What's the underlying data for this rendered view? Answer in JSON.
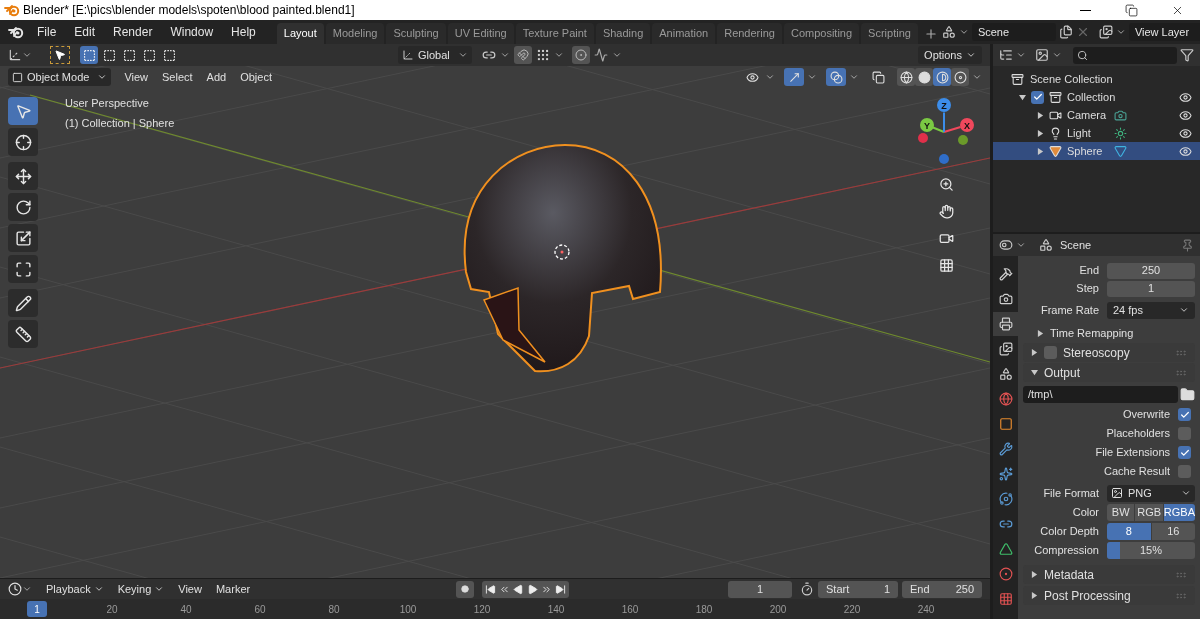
{
  "window": {
    "title": "Blender* [E:\\pics\\blender models\\spoten\\blood painted.blend1]"
  },
  "menus": [
    "File",
    "Edit",
    "Render",
    "Window",
    "Help"
  ],
  "workspaces": [
    {
      "label": "Layout",
      "selected": true
    },
    {
      "label": "Modeling",
      "selected": false
    },
    {
      "label": "Sculpting",
      "selected": false
    },
    {
      "label": "UV Editing",
      "selected": false
    },
    {
      "label": "Texture Paint",
      "selected": false
    },
    {
      "label": "Shading",
      "selected": false
    },
    {
      "label": "Animation",
      "selected": false
    },
    {
      "label": "Rendering",
      "selected": false
    },
    {
      "label": "Compositing",
      "selected": false
    },
    {
      "label": "Scripting",
      "selected": false
    }
  ],
  "scene": {
    "value": "Scene"
  },
  "view_layer": {
    "value": "View Layer"
  },
  "tool_header": {
    "select_modes": [
      {
        "selected": true
      },
      {
        "selected": false
      },
      {
        "selected": false
      },
      {
        "selected": false
      },
      {
        "selected": false
      }
    ],
    "orientation": "Global",
    "options": "Options"
  },
  "viewport_header": {
    "mode": "Object Mode",
    "menus": [
      "View",
      "Select",
      "Add",
      "Object"
    ],
    "toggles": [
      {
        "kind": "visibility",
        "on": false
      },
      {
        "kind": "gizmo",
        "on": true
      },
      {
        "kind": "overlay",
        "on": true
      },
      {
        "kind": "xray",
        "on": false
      }
    ],
    "shading": [
      {
        "kind": "wireframe",
        "selected": false
      },
      {
        "kind": "solid",
        "selected": false
      },
      {
        "kind": "material",
        "selected": true
      },
      {
        "kind": "rendered",
        "selected": false
      }
    ]
  },
  "viewport": {
    "overlay_text": [
      "User Perspective",
      "(1) Collection | Sphere"
    ],
    "gizmo_axes": {
      "z": "Z",
      "y": "Y",
      "x": "X"
    }
  },
  "tool_groups": [
    [
      {
        "kind": "select",
        "selected": true
      },
      {
        "kind": "cursor",
        "selected": false
      }
    ],
    [
      {
        "kind": "move",
        "selected": false
      },
      {
        "kind": "rotate",
        "selected": false
      },
      {
        "kind": "scale",
        "selected": false
      },
      {
        "kind": "transform",
        "selected": false
      }
    ],
    [
      {
        "kind": "annotate",
        "selected": false
      },
      {
        "kind": "measure",
        "selected": false
      }
    ]
  ],
  "timeline": {
    "menus": [
      {
        "label": "Playback",
        "dropdown": true
      },
      {
        "label": "Keying",
        "dropdown": true
      },
      {
        "label": "View",
        "dropdown": false
      },
      {
        "label": "Marker",
        "dropdown": false
      }
    ],
    "current_frame": "1",
    "start_label": "Start",
    "start": "1",
    "end_label": "End",
    "end": "250",
    "ruler": {
      "current": "1",
      "ticks": [
        "20",
        "40",
        "60",
        "80",
        "100",
        "120",
        "140",
        "160",
        "180",
        "200",
        "220",
        "240"
      ]
    }
  },
  "outliner": {
    "root": "Scene Collection",
    "tree": [
      {
        "label": "Collection",
        "expanded": true,
        "checked": true,
        "selected": false,
        "children": [
          {
            "label": "Camera",
            "kind": "camera",
            "expanded": false,
            "selected": false
          },
          {
            "label": "Light",
            "kind": "light",
            "expanded": false,
            "selected": false
          },
          {
            "label": "Sphere",
            "kind": "mesh",
            "expanded": false,
            "selected": true
          }
        ]
      }
    ]
  },
  "properties": {
    "context": "Scene",
    "tabs": [
      {
        "kind": "tool",
        "selected": false
      },
      {
        "kind": "render",
        "selected": false
      },
      {
        "kind": "output",
        "selected": true
      },
      {
        "kind": "view_layer",
        "selected": false
      },
      {
        "kind": "scene",
        "selected": false
      },
      {
        "kind": "world",
        "selected": false
      },
      {
        "kind": "object",
        "selected": false
      },
      {
        "kind": "modifier",
        "selected": false
      },
      {
        "kind": "particles",
        "selected": false
      },
      {
        "kind": "physics",
        "selected": false
      },
      {
        "kind": "constraints",
        "selected": false
      },
      {
        "kind": "data",
        "selected": false
      },
      {
        "kind": "material",
        "selected": false
      },
      {
        "kind": "texture",
        "selected": false
      }
    ],
    "frame_fields": [
      {
        "label": "End",
        "value": "250"
      },
      {
        "label": "Step",
        "value": "1"
      }
    ],
    "frame_rate": {
      "label": "Frame Rate",
      "value": "24 fps"
    },
    "time_remapping": {
      "label": "Time Remapping",
      "expanded": false
    },
    "stereoscopy": {
      "label": "Stereoscopy",
      "expanded": false,
      "checked": false
    },
    "output": {
      "label": "Output",
      "expanded": true,
      "path": "/tmp\\",
      "toggles": [
        {
          "label": "Overwrite",
          "checked": true
        },
        {
          "label": "Placeholders",
          "checked": false
        },
        {
          "label": "File Extensions",
          "checked": true
        },
        {
          "label": "Cache Result",
          "checked": false
        }
      ],
      "file_format": {
        "label": "File Format",
        "value": "PNG"
      },
      "color": {
        "label": "Color",
        "options": [
          {
            "label": "BW",
            "selected": false
          },
          {
            "label": "RGB",
            "selected": false
          },
          {
            "label": "RGBA",
            "selected": true
          }
        ]
      },
      "color_depth": {
        "label": "Color Depth",
        "options": [
          {
            "label": "8",
            "selected": true
          },
          {
            "label": "16",
            "selected": false
          }
        ]
      },
      "compression": {
        "label": "Compression",
        "value": "15%",
        "level": 0.15
      }
    },
    "closed_panels": [
      {
        "label": "Metadata",
        "expanded": false
      },
      {
        "label": "Post Processing",
        "expanded": false
      }
    ]
  }
}
